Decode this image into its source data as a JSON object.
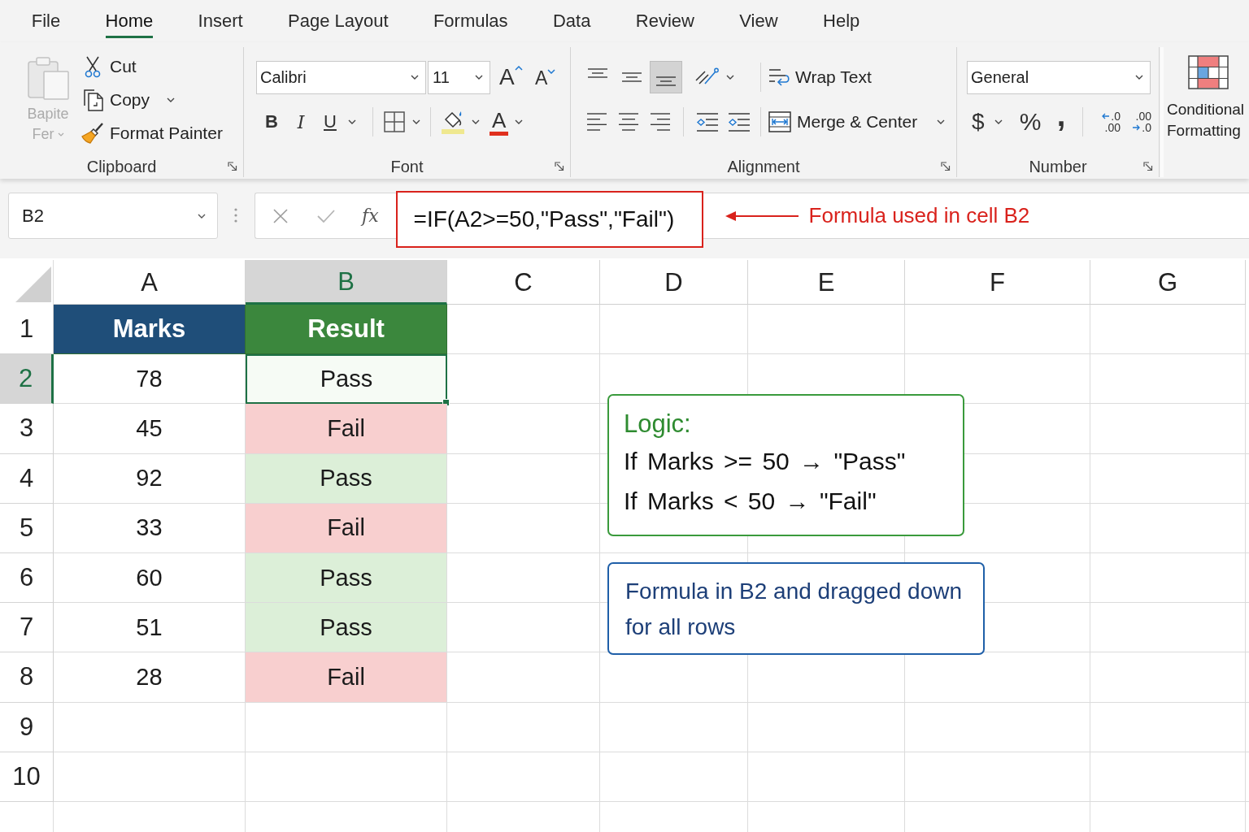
{
  "menu_tabs": [
    {
      "label": "File",
      "selected": false
    },
    {
      "label": "Home",
      "selected": true
    },
    {
      "label": "Insert",
      "selected": false
    },
    {
      "label": "Page Layout",
      "selected": false
    },
    {
      "label": "Formulas",
      "selected": false
    },
    {
      "label": "Data",
      "selected": false
    },
    {
      "label": "Review",
      "selected": false
    },
    {
      "label": "View",
      "selected": false
    },
    {
      "label": "Help",
      "selected": false
    }
  ],
  "ribbon": {
    "clipboard": {
      "paste": {
        "lines": [
          "Bapite",
          "Fer"
        ],
        "disabled": true,
        "dropdown": true
      },
      "commands": [
        {
          "kind": "cut",
          "label": "Cut",
          "dropdown": false
        },
        {
          "kind": "copy",
          "label": "Copy",
          "dropdown": true
        },
        {
          "kind": "format_painter",
          "label": "Format Painter",
          "dropdown": false
        }
      ],
      "label": "Clipboard"
    },
    "font": {
      "font_name": "Calibri",
      "font_size": "11",
      "size_buttons": [
        {
          "kind": "grow",
          "label": "A"
        },
        {
          "kind": "shrink",
          "label": "A"
        }
      ],
      "style_buttons": [
        {
          "kind": "bold",
          "label": "B",
          "dropdown": false
        },
        {
          "kind": "italic",
          "label": "I",
          "dropdown": false
        },
        {
          "kind": "underline",
          "label": "U",
          "dropdown": true
        }
      ],
      "font_color_label": "A",
      "label": "Font"
    },
    "alignment": {
      "vertical": [
        {
          "kind": "top",
          "selected": false
        },
        {
          "kind": "middle",
          "selected": false
        },
        {
          "kind": "bottom",
          "selected": true
        }
      ],
      "horizontal": [
        {
          "kind": "left",
          "selected": false
        },
        {
          "kind": "center",
          "selected": false
        },
        {
          "kind": "right",
          "selected": false
        }
      ],
      "wrap_text": "Wrap Text",
      "merge": "Merge & Center",
      "label": "Alignment"
    },
    "number": {
      "format": "General",
      "buttons": [
        {
          "kind": "currency",
          "label": "$",
          "dropdown": true
        },
        {
          "kind": "percent",
          "label": "%",
          "dropdown": false
        },
        {
          "kind": "comma",
          "label": ",",
          "dropdown": false
        }
      ],
      "decimals": [
        {
          "kind": "increase",
          "top": ".0",
          "bottom": ".00"
        },
        {
          "kind": "decrease",
          "top": ".00",
          "bottom": ".0"
        }
      ],
      "label": "Number"
    },
    "conditional_formatting": {
      "label": "Conditional Formatting"
    }
  },
  "formula_bar": {
    "name_box": "B2",
    "fx": "fx",
    "formula": "=IF(A2>=50,\"Pass\",\"Fail\")",
    "annotation": "Formula used in cell B2"
  },
  "sheet": {
    "columns": [
      {
        "label": "A",
        "selected": false
      },
      {
        "label": "B",
        "selected": true
      },
      {
        "label": "C",
        "selected": false
      },
      {
        "label": "D",
        "selected": false
      },
      {
        "label": "E",
        "selected": false
      },
      {
        "label": "F",
        "selected": false
      },
      {
        "label": "G",
        "selected": false
      }
    ],
    "rows": [
      {
        "label": "1",
        "selected": false,
        "cells": [
          {
            "text": "Marks",
            "kind": "header",
            "color": "#1f4e79",
            "selected": false
          },
          {
            "text": "Result",
            "kind": "header",
            "color": "#3b873d",
            "selected": false
          }
        ]
      },
      {
        "label": "2",
        "selected": true,
        "cells": [
          {
            "text": "78",
            "kind": "value",
            "selected": false
          },
          {
            "text": "Pass",
            "kind": "value",
            "selected": true
          }
        ]
      },
      {
        "label": "3",
        "selected": false,
        "cells": [
          {
            "text": "45",
            "kind": "value",
            "selected": false
          },
          {
            "text": "Fail",
            "kind": "value",
            "color": "#f8cfcf",
            "selected": false
          }
        ]
      },
      {
        "label": "4",
        "selected": false,
        "cells": [
          {
            "text": "92",
            "kind": "value",
            "selected": false
          },
          {
            "text": "Pass",
            "kind": "value",
            "color": "#dcefd8",
            "selected": false
          }
        ]
      },
      {
        "label": "5",
        "selected": false,
        "cells": [
          {
            "text": "33",
            "kind": "value",
            "selected": false
          },
          {
            "text": "Fail",
            "kind": "value",
            "color": "#f8cfcf",
            "selected": false
          }
        ]
      },
      {
        "label": "6",
        "selected": false,
        "cells": [
          {
            "text": "60",
            "kind": "value",
            "selected": false
          },
          {
            "text": "Pass",
            "kind": "value",
            "color": "#dcefd8",
            "selected": false
          }
        ]
      },
      {
        "label": "7",
        "selected": false,
        "cells": [
          {
            "text": "51",
            "kind": "value",
            "selected": false
          },
          {
            "text": "Pass",
            "kind": "value",
            "color": "#dcefd8",
            "selected": false
          }
        ]
      },
      {
        "label": "8",
        "selected": false,
        "cells": [
          {
            "text": "28",
            "kind": "value",
            "selected": false
          },
          {
            "text": "Fail",
            "kind": "value",
            "color": "#f8cfcf",
            "selected": false
          }
        ]
      },
      {
        "label": "9",
        "selected": false
      },
      {
        "label": "10",
        "selected": false
      }
    ],
    "notes": [
      {
        "kind": "logic",
        "title": "Logic:",
        "lines": [
          "If Marks >= 50 → \"Pass\"",
          "If Marks < 50 → \"Fail\""
        ]
      },
      {
        "kind": "info",
        "text": "Formula in B2 and dragged down for all rows"
      }
    ]
  }
}
